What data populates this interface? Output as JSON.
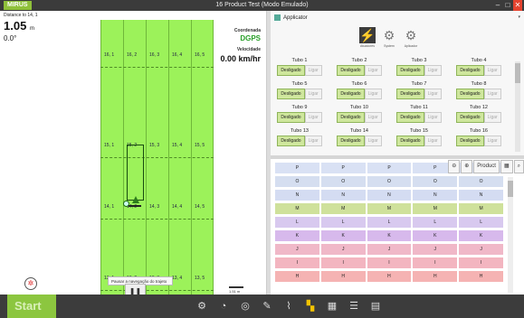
{
  "window": {
    "logo": "MIRUS",
    "title": "16 Product Test (Modo Emulado)",
    "minimize": "–",
    "maximize": "□",
    "close": "✕"
  },
  "left": {
    "distance_label": "Distance to 14, 1",
    "distance_value": "1.05",
    "distance_unit": "m",
    "heading": "0.0°",
    "coord_label": "Coordenada",
    "coord_value": "DGPS",
    "speed_label": "Velocidade",
    "speed_value": "0.00 km/hr",
    "field_labels_top": [
      "16, 1",
      "16, 2",
      "16, 3",
      "16, 4",
      "16, 5"
    ],
    "field_labels_mid": [
      "15, 1",
      "15, 2",
      "15, 3",
      "15, 4",
      "15, 5"
    ],
    "field_labels_low": [
      "14, 1",
      "14, 2",
      "14, 3",
      "14, 4",
      "14, 5"
    ],
    "field_labels_bot": [
      "13, 1",
      "13, 2",
      "13, 3",
      "13, 4",
      "13, 5"
    ],
    "tooltip": "Pausar a navegação do trajeto",
    "pause_icon": "❚❚",
    "scale": "1.51 m",
    "compass_icon": "✲"
  },
  "applicator": {
    "header": "Applicator",
    "tabs": [
      {
        "label": "Atuadores",
        "icon": "⚡"
      },
      {
        "label": "System",
        "icon": "⚙"
      },
      {
        "label": "Aplicador",
        "icon": "⚙"
      }
    ],
    "tubes": [
      {
        "name": "Tubo 1",
        "off": "Desligado",
        "on": "Ligar"
      },
      {
        "name": "Tubo 2",
        "off": "Desligado",
        "on": "Ligar"
      },
      {
        "name": "Tubo 3",
        "off": "Desligado",
        "on": "Ligar"
      },
      {
        "name": "Tubo 4",
        "off": "Desligado",
        "on": "Ligar"
      },
      {
        "name": "Tubo 5",
        "off": "Desligado",
        "on": "Ligar"
      },
      {
        "name": "Tubo 6",
        "off": "Desligado",
        "on": "Ligar"
      },
      {
        "name": "Tubo 7",
        "off": "Desligado",
        "on": "Ligar"
      },
      {
        "name": "Tubo 8",
        "off": "Desligado",
        "on": "Ligar"
      },
      {
        "name": "Tubo 9",
        "off": "Desligado",
        "on": "Ligar"
      },
      {
        "name": "Tubo 10",
        "off": "Desligado",
        "on": "Ligar"
      },
      {
        "name": "Tubo 11",
        "off": "Desligado",
        "on": "Ligar"
      },
      {
        "name": "Tubo 12",
        "off": "Desligado",
        "on": "Ligar"
      },
      {
        "name": "Tubo 13",
        "off": "Desligado",
        "on": "Ligar"
      },
      {
        "name": "Tubo 14",
        "off": "Desligado",
        "on": "Ligar"
      },
      {
        "name": "Tubo 15",
        "off": "Desligado",
        "on": "Ligar"
      },
      {
        "name": "Tubo 16",
        "off": "Desligado",
        "on": "Ligar"
      }
    ]
  },
  "rates": {
    "toolbar": {
      "zoom_out": "⊖",
      "zoom_in": "⊕",
      "product": "Product",
      "grid": "▦",
      "search": "⌕"
    },
    "rows": [
      {
        "letter": "P",
        "color": "#d9e1f4"
      },
      {
        "letter": "O",
        "color": "#d5def0"
      },
      {
        "letter": "N",
        "color": "#d4dcf2"
      },
      {
        "letter": "M",
        "color": "#cfe19b"
      },
      {
        "letter": "L",
        "color": "#d8c9ef"
      },
      {
        "letter": "K",
        "color": "#d7b9ec"
      },
      {
        "letter": "J",
        "color": "#f0b8c8"
      },
      {
        "letter": "I",
        "color": "#f3b5c0"
      },
      {
        "letter": "H",
        "color": "#f5b3b3"
      }
    ]
  },
  "bottom": {
    "start": "Start",
    "icons": [
      "gears-icon",
      "chart-pie-icon",
      "gauge-icon",
      "pen-icon",
      "line-chart-icon",
      "grid-small-icon",
      "grid-large-icon",
      "list-icon",
      "table-icon"
    ]
  }
}
